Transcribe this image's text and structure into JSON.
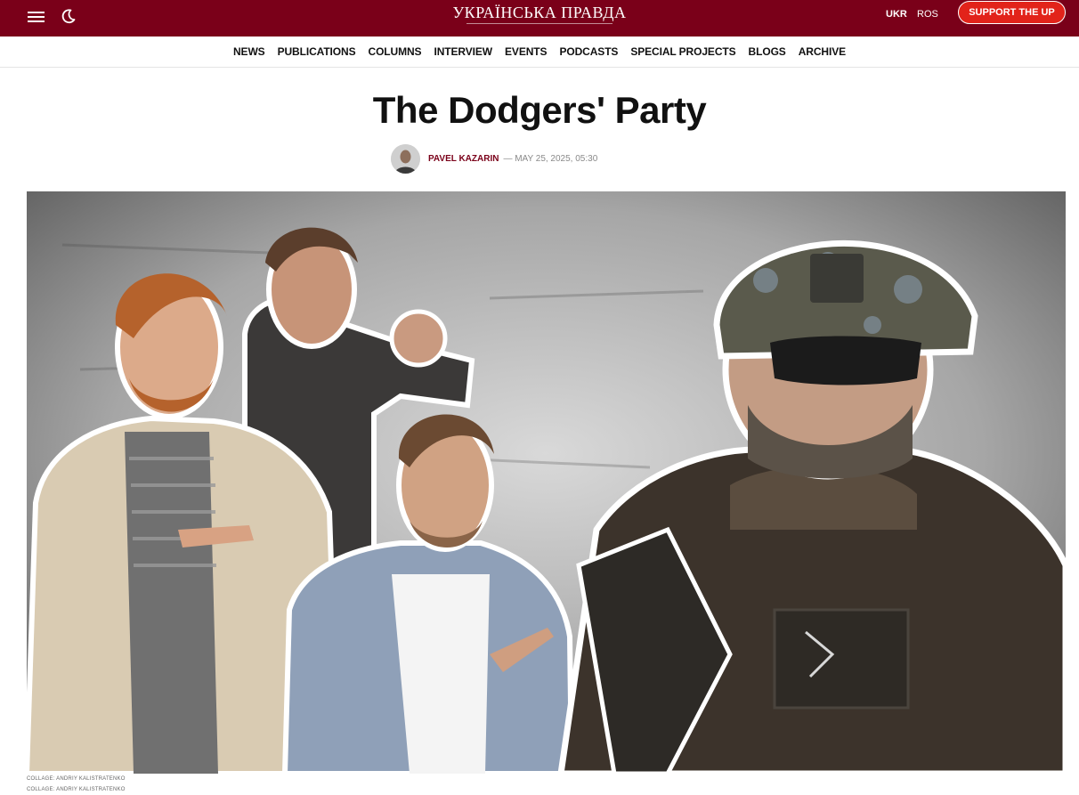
{
  "header": {
    "logo_text": "УКРАЇНСЬКА ПРАВДА",
    "menu_icon": "hamburger-menu-icon",
    "theme_icon": "moon-icon",
    "languages": [
      {
        "label": "UKR",
        "active": true
      },
      {
        "label": "ROS",
        "active": false
      }
    ],
    "support_label": "SUPPORT THE UP",
    "brand_color": "#7a0019",
    "support_color": "#e2231a"
  },
  "nav": {
    "items": [
      "NEWS",
      "PUBLICATIONS",
      "COLUMNS",
      "INTERVIEW",
      "EVENTS",
      "PODCASTS",
      "SPECIAL PROJECTS",
      "BLOGS",
      "ARCHIVE"
    ]
  },
  "article": {
    "title": "The Dodgers' Party",
    "author": "PAVEL KAZARIN",
    "date": "— MAY 25, 2025, 05:30",
    "image_alt": "collage: three men in civilian clothes pointing at a soldier in helmet and sunglasses",
    "captions": [
      "COLLAGE: ANDRIY KALISTRATENKO",
      "COLLAGE: ANDRIY KALISTRATENKO"
    ]
  }
}
